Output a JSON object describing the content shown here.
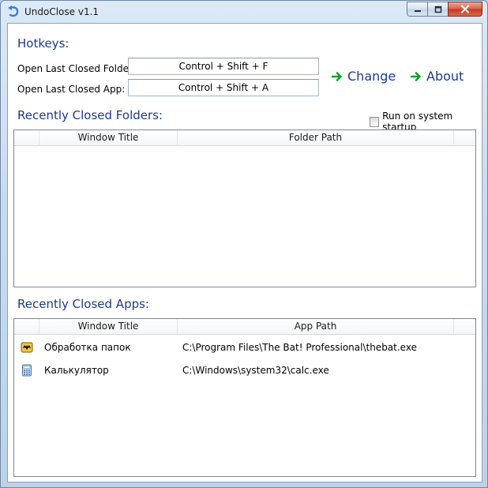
{
  "window": {
    "title": "UndoClose v1.1"
  },
  "hotkeys": {
    "heading": "Hotkeys:",
    "folder_label": "Open Last Closed Folder:",
    "folder_value": "Control + Shift + F",
    "app_label": "Open Last Closed App:",
    "app_value": "Control + Shift + A"
  },
  "actions": {
    "change_label": "Change",
    "about_label": "About",
    "icon": "green-arrow-icon",
    "accent": "#1aa02a"
  },
  "startup": {
    "label": "Run on system startup",
    "checked": false
  },
  "folders": {
    "heading": "Recently Closed Folders:",
    "columns": [
      "Window Title",
      "Folder Path"
    ],
    "rows": []
  },
  "apps": {
    "heading": "Recently Closed Apps:",
    "columns": [
      "Window Title",
      "App Path"
    ],
    "rows": [
      {
        "icon": "thebat-icon",
        "title": "Обработка папок",
        "path": "C:\\Program Files\\The Bat! Professional\\thebat.exe"
      },
      {
        "icon": "calculator-icon",
        "title": "Калькулятор",
        "path": "C:\\Windows\\system32\\calc.exe"
      }
    ]
  },
  "colors": {
    "heading": "#1e3a8a",
    "title_frame": "#c9dcef"
  }
}
